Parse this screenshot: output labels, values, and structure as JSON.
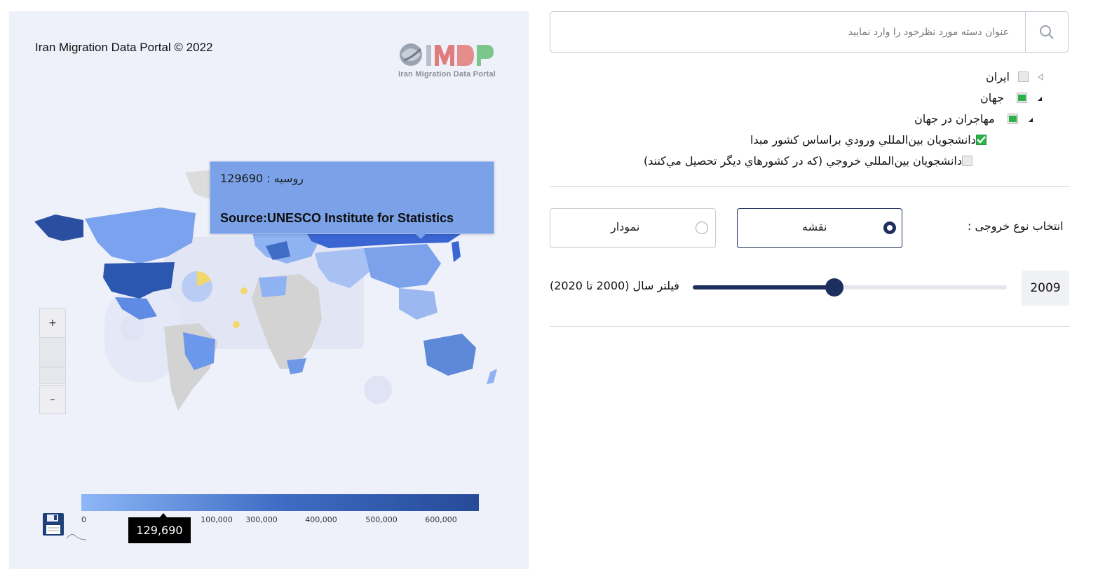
{
  "map": {
    "title": "Iran Migration Data Portal © 2022",
    "logo": {
      "wordmark": "IMDP",
      "subtitle": "Iran Migration Data Portal"
    },
    "tooltip": {
      "line": "روسیه : 129690",
      "source": "Source:UNESCO Institute for Statistics"
    },
    "zoom": {
      "in_label": "+",
      "out_label": "–"
    },
    "legend": {
      "ticks": [
        "0",
        "100,000",
        "300,000",
        "400,000",
        "500,000",
        "600,000"
      ],
      "current_value": "129,690",
      "colors": {
        "low": "#8db7f7",
        "mid": "#3f6cc4",
        "high": "#264b98"
      }
    },
    "icons": {
      "save": "floppy-disk-icon",
      "search": "search-icon"
    }
  },
  "search": {
    "placeholder": "عنوان دسته مورد نظرخود را وارد نمایید",
    "value": ""
  },
  "tree": {
    "items": [
      {
        "label": "ایران",
        "checked": "none"
      },
      {
        "label": "جهان",
        "checked": "partial"
      },
      {
        "label": "مهاجران در جهان",
        "checked": "partial"
      },
      {
        "label": "دانشجويان بين‌المللي ورودي براساس كشور مبدا",
        "checked": "checked"
      },
      {
        "label": "دانشجويان بين‌المللي خروجي (كه در كشورهاي ديگر تحصيل مي‌كنند)",
        "checked": "none"
      }
    ]
  },
  "output": {
    "label": "انتخاب نوع خروجی :",
    "options": [
      {
        "label": "نقشه",
        "selected": true
      },
      {
        "label": "نمودار",
        "selected": false
      }
    ]
  },
  "year_filter": {
    "label": "فیلتر سال (2000 تا 2020)",
    "value": "2009",
    "progress": 0.45
  },
  "colors": {
    "accent": "#1e2f5e",
    "check": "#2db14a"
  }
}
